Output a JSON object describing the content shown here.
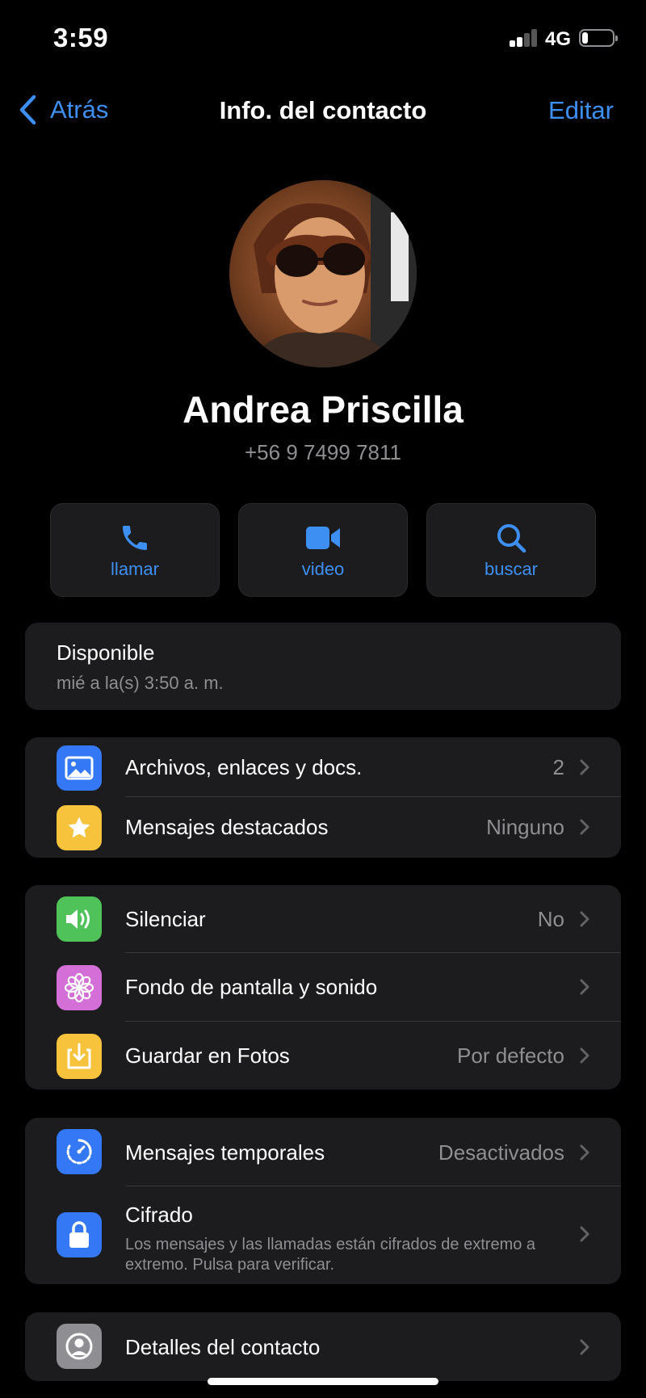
{
  "status_bar": {
    "time": "3:59",
    "network": "4G",
    "battery_level": 0.2
  },
  "nav": {
    "back_label": "Atrás",
    "title": "Info. del contacto",
    "edit_label": "Editar"
  },
  "contact": {
    "name": "Andrea Priscilla",
    "phone": "+56 9 7499 7811"
  },
  "actions": [
    {
      "label": "llamar",
      "icon": "phone-icon"
    },
    {
      "label": "video",
      "icon": "video-camera-icon"
    },
    {
      "label": "buscar",
      "icon": "search-icon"
    }
  ],
  "about": {
    "text": "Disponible",
    "date": "mié a la(s) 3:50 a. m."
  },
  "media_group": [
    {
      "label": "Archivos, enlaces y docs.",
      "value": "2",
      "icon": "photo-icon",
      "color": "#3478f6"
    },
    {
      "label": "Mensajes destacados",
      "value": "Ninguno",
      "icon": "star-icon",
      "color": "#f7c23c"
    }
  ],
  "settings_group": [
    {
      "label": "Silenciar",
      "value": "No",
      "icon": "speaker-icon",
      "color": "#4fc35a"
    },
    {
      "label": "Fondo de pantalla y sonido",
      "value": "",
      "icon": "flower-icon",
      "color": "#d36fd6"
    },
    {
      "label": "Guardar en Fotos",
      "value": "Por defecto",
      "icon": "download-icon",
      "color": "#f7c23c"
    }
  ],
  "privacy_group": {
    "disappearing": {
      "label": "Mensajes temporales",
      "value": "Desactivados",
      "icon": "timer-icon",
      "color": "#3478f6"
    },
    "encryption": {
      "label": "Cifrado",
      "description": "Los mensajes y las llamadas están cifrados de extremo a extremo. Pulsa para verificar.",
      "icon": "lock-icon",
      "color": "#3478f6"
    }
  },
  "details": {
    "label": "Detalles del contacto",
    "icon": "contact-person-icon",
    "color": "#8e8e93"
  },
  "colors": {
    "accent": "#3d8ff2",
    "background": "#000000",
    "card": "#1c1c1e",
    "secondary_text": "#8e8e93"
  }
}
